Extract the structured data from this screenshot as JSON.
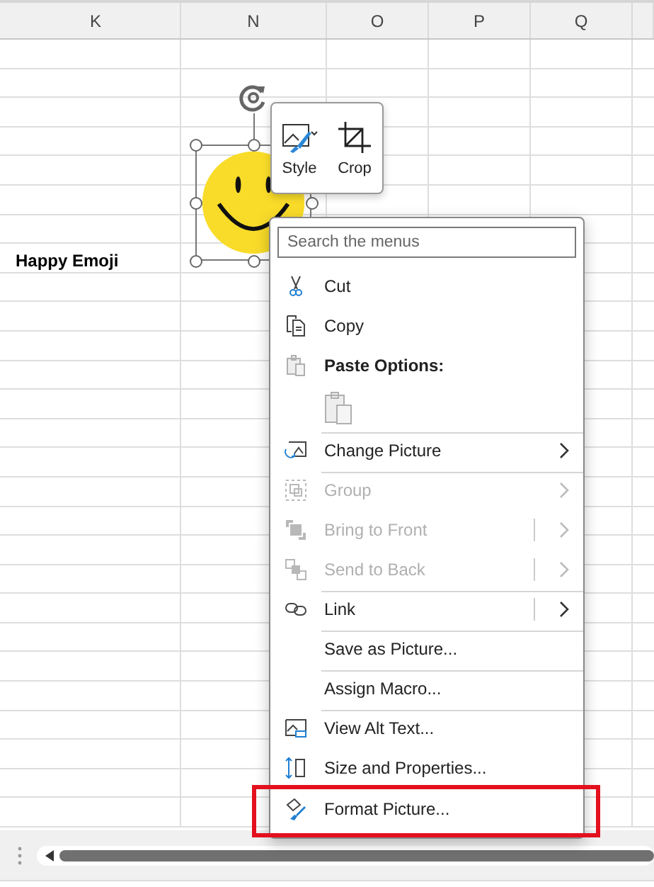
{
  "columns": [
    {
      "label": "K"
    },
    {
      "label": "N"
    },
    {
      "label": "O"
    },
    {
      "label": "P"
    },
    {
      "label": "Q"
    }
  ],
  "cell_text": "Happy Emoji",
  "mini_toolbar": [
    {
      "label": "Style",
      "kind": "style"
    },
    {
      "label": "Crop",
      "kind": "crop"
    }
  ],
  "context_menu": {
    "search": {
      "placeholder": "Search the menus"
    },
    "items": [
      {
        "kind": "command",
        "label": "Cut",
        "disabled": false,
        "submenu": false,
        "split": false,
        "separator_before": false,
        "annotated": false
      },
      {
        "kind": "command",
        "label": "Copy",
        "disabled": false,
        "submenu": false,
        "split": false,
        "separator_before": false,
        "annotated": false
      },
      {
        "kind": "header",
        "label": "Paste Options:",
        "disabled": false,
        "submenu": false,
        "split": false,
        "separator_before": false,
        "annotated": false
      },
      {
        "kind": "paste-option",
        "disabled": true
      },
      {
        "kind": "command",
        "label": "Change Picture",
        "disabled": false,
        "submenu": true,
        "split": false,
        "separator_before": true,
        "annotated": false
      },
      {
        "kind": "command",
        "label": "Group",
        "disabled": true,
        "submenu": true,
        "split": false,
        "separator_before": true,
        "annotated": false
      },
      {
        "kind": "command",
        "label": "Bring to Front",
        "disabled": true,
        "submenu": true,
        "split": true,
        "separator_before": false,
        "annotated": false
      },
      {
        "kind": "command",
        "label": "Send to Back",
        "disabled": true,
        "submenu": true,
        "split": true,
        "separator_before": false,
        "annotated": false
      },
      {
        "kind": "command",
        "label": "Link",
        "disabled": false,
        "submenu": true,
        "split": true,
        "separator_before": true,
        "annotated": false
      },
      {
        "kind": "command",
        "label": "Save as Picture...",
        "disabled": false,
        "submenu": false,
        "split": false,
        "separator_before": true,
        "annotated": false
      },
      {
        "kind": "command",
        "label": "Assign Macro...",
        "disabled": false,
        "submenu": false,
        "split": false,
        "separator_before": true,
        "annotated": false
      },
      {
        "kind": "command",
        "label": "View Alt Text...",
        "disabled": false,
        "submenu": false,
        "split": false,
        "separator_before": true,
        "annotated": false
      },
      {
        "kind": "command",
        "label": "Size and Properties...",
        "disabled": false,
        "submenu": false,
        "split": false,
        "separator_before": false,
        "annotated": false
      },
      {
        "kind": "command",
        "label": "Format Picture...",
        "disabled": false,
        "submenu": false,
        "split": false,
        "separator_before": false,
        "annotated": true
      }
    ]
  }
}
